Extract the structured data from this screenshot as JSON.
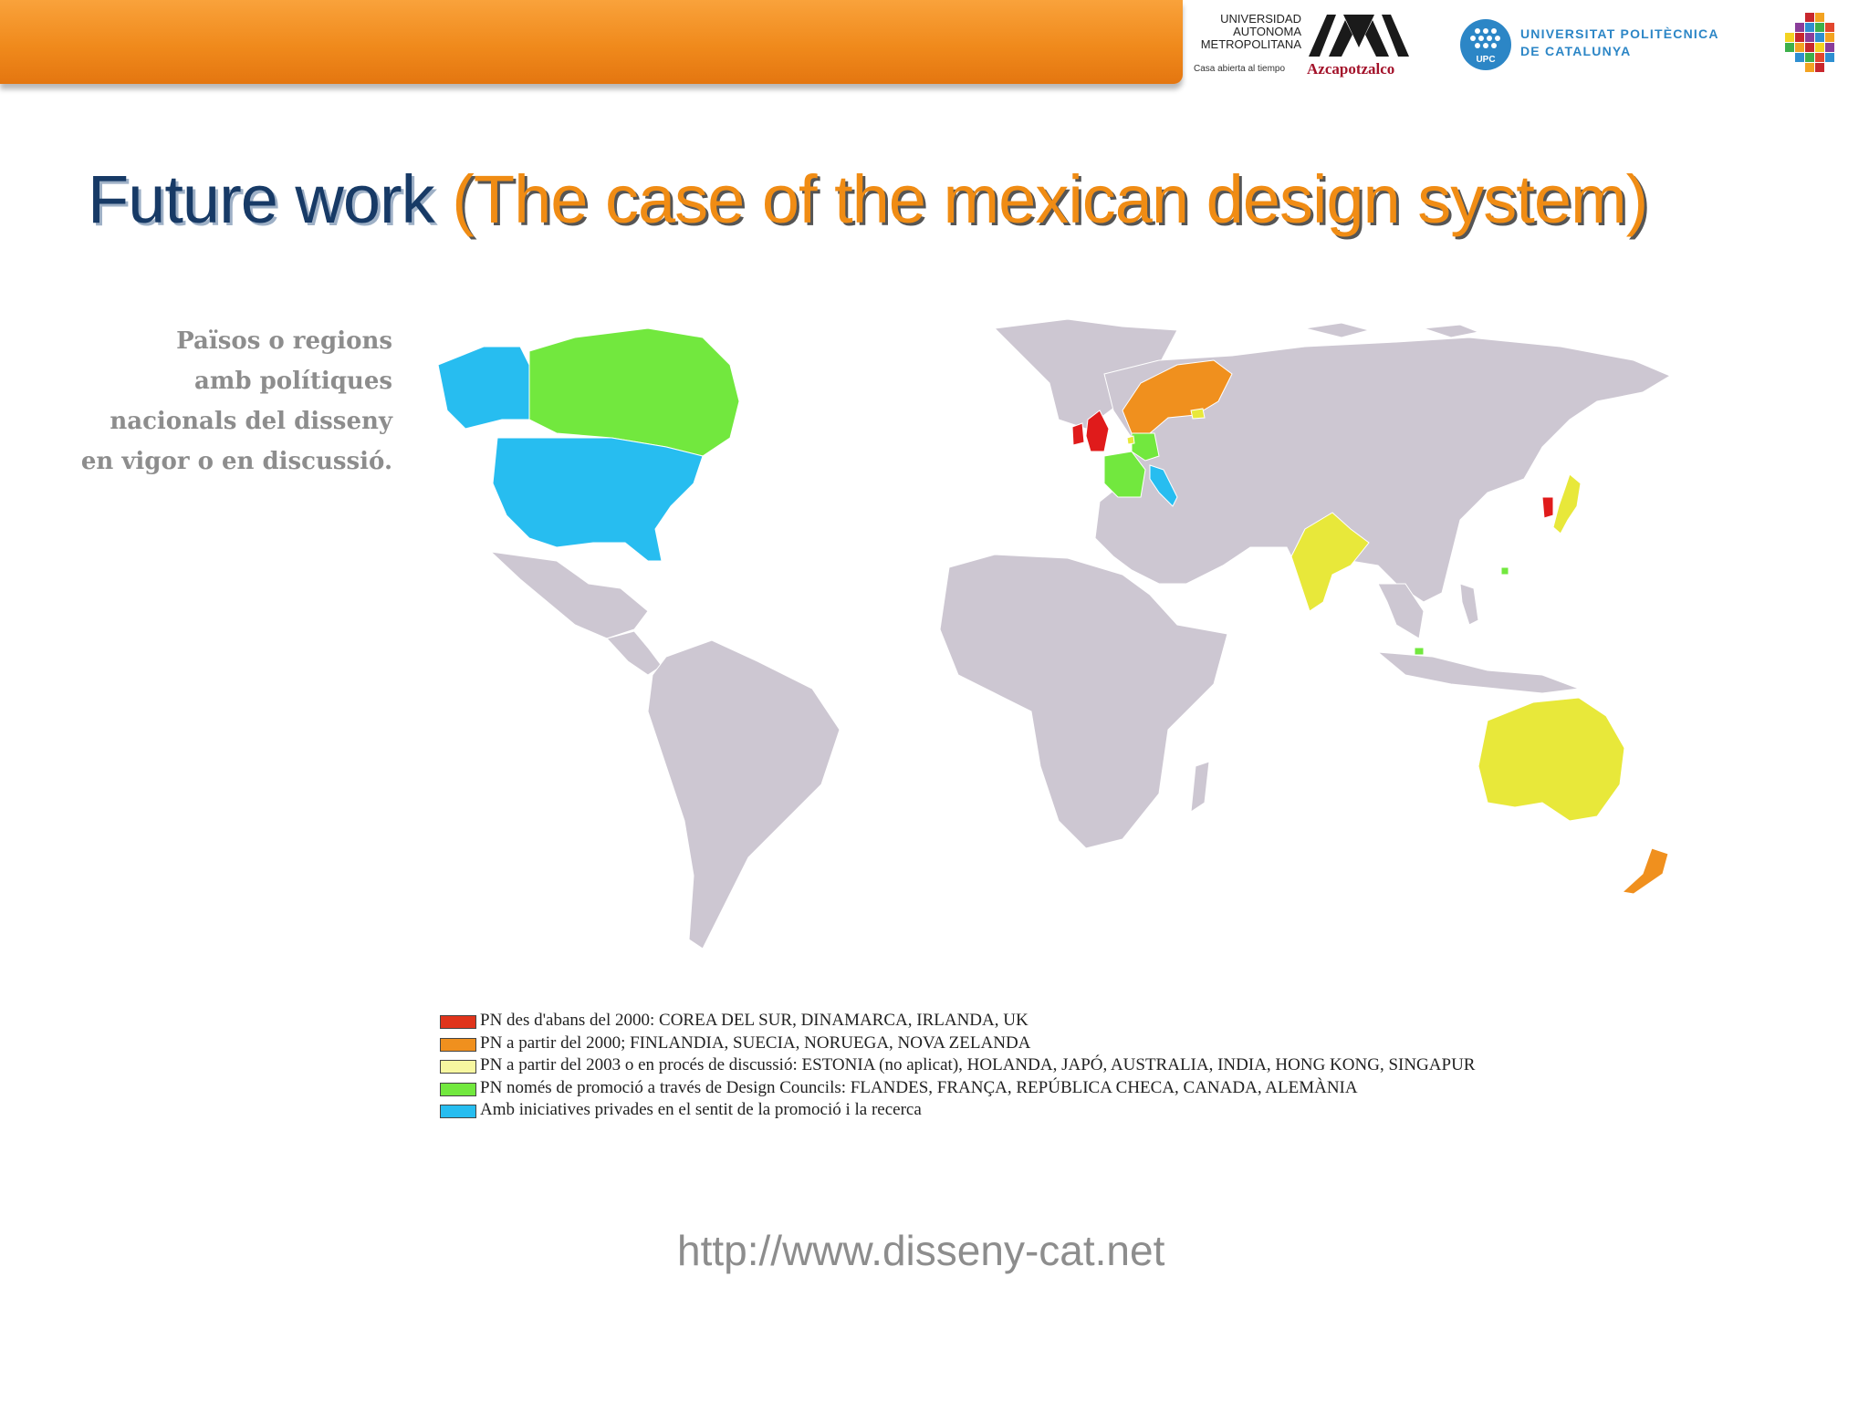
{
  "header": {
    "uam_name_lines": [
      "UNIVERSIDAD",
      "AUTONOMA",
      "METROPOLITANA"
    ],
    "uam_tagline": "Casa abierta al tiempo",
    "uam_campus": "Azcapotzalco",
    "upc_name_lines": [
      "UNIVERSITAT POLITÈCNICA",
      "DE CATALUNYA"
    ],
    "upc_abbr": "UPC"
  },
  "title": {
    "part1": "Future work",
    "part2": "(The case of the mexican design system)"
  },
  "side_note": [
    "Països o regions",
    "amb polítiques",
    "nacionals del disseny",
    "en vigor o en discussió."
  ],
  "map": {
    "colors": {
      "ocean": "#ffffff",
      "land": "#cdc7d2",
      "red": "#e01b1b",
      "orange": "#f0901e",
      "yellow": "#e8e83a",
      "green": "#72e83e",
      "cyan": "#27bdf0"
    }
  },
  "legend": [
    {
      "color": "#e0341b",
      "label": "PN des d'abans del 2000: COREA DEL SUR, DINAMARCA, IRLANDA, UK"
    },
    {
      "color": "#f0901e",
      "label": "PN a partir del 2000; FINLANDIA, SUECIA, NORUEGA, NOVA ZELANDA"
    },
    {
      "color": "#f7f7a0",
      "label": "PN a partir del 2003 o en procés de discussió: ESTONIA (no aplicat), HOLANDA, JAPÓ, AUSTRALIA, INDIA, HONG KONG, SINGAPUR"
    },
    {
      "color": "#72e83e",
      "label": "PN només de promoció a través de Design Councils: FLANDES, FRANÇA, REPÚBLICA CHECA, CANADA, ALEMÀNIA"
    },
    {
      "color": "#27bdf0",
      "label": "Amb iniciatives privades en el sentit de la promoció i la recerca"
    }
  ],
  "url": "http://www.disseny-cat.net"
}
